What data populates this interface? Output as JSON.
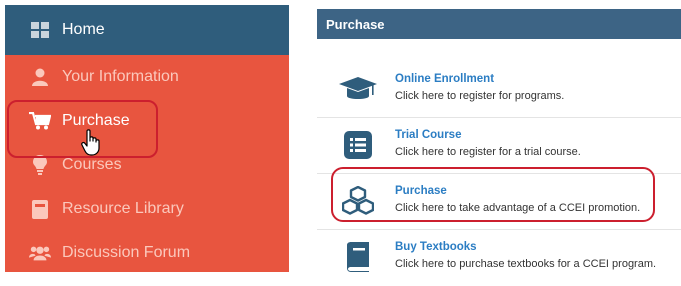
{
  "sidebar": {
    "items": [
      {
        "label": "Home",
        "icon": "grid-icon"
      },
      {
        "label": "Your Information",
        "icon": "user-icon"
      },
      {
        "label": "Purchase",
        "icon": "cart-icon"
      },
      {
        "label": "Courses",
        "icon": "lightbulb-icon"
      },
      {
        "label": "Resource Library",
        "icon": "book-icon"
      },
      {
        "label": "Discussion Forum",
        "icon": "users-icon"
      }
    ]
  },
  "panel": {
    "title": "Purchase",
    "items": [
      {
        "title": "Online Enrollment",
        "desc": "Click here to register for programs.",
        "icon": "graduation-cap-icon"
      },
      {
        "title": "Trial Course",
        "desc": "Click here to register for a trial course.",
        "icon": "list-icon"
      },
      {
        "title": "Purchase",
        "desc": "Click here to take advantage of a CCEI promotion.",
        "icon": "cubes-icon"
      },
      {
        "title": "Buy Textbooks",
        "desc": "Click here to purchase textbooks for a CCEI program.",
        "icon": "textbook-icon"
      }
    ]
  },
  "colors": {
    "sidebar_bg": "#e8553f",
    "home_bg": "#2f5d7c",
    "panel_header_bg": "#3d6485",
    "link_blue": "#2b7dc3",
    "highlight_red": "#cc1f2e"
  }
}
